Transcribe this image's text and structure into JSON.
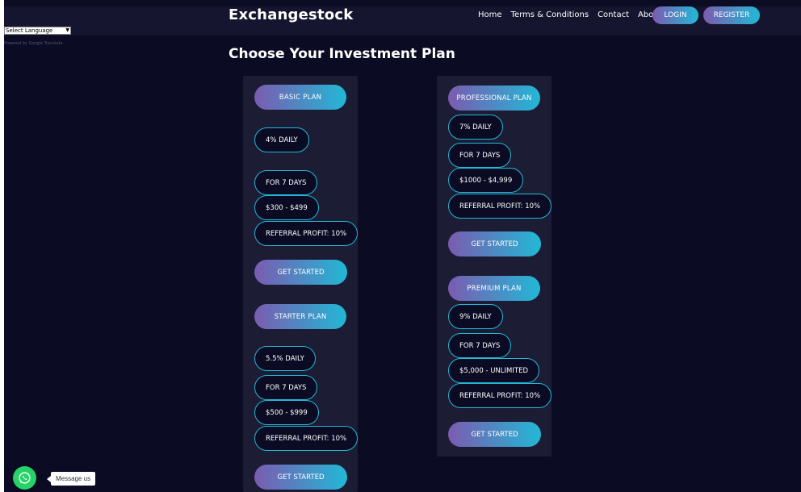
{
  "header": {
    "brand": "Exchangestock",
    "nav": [
      "Home",
      "Terms & Conditions",
      "Contact",
      "About"
    ],
    "login_label": "LOGIN",
    "register_label": "REGISTER"
  },
  "translate": {
    "select_label": "Select Language",
    "powered_by": "Powered by Google Translate"
  },
  "main": {
    "title": "Choose Your Investment Plan"
  },
  "plans": {
    "basic": {
      "name": "BASIC PLAN",
      "rate": "4% DAILY",
      "duration": "FOR 7 DAYS",
      "range": "$300 - $499",
      "referral": "REFERRAL PROFIT: 10%",
      "cta": "GET STARTED"
    },
    "starter": {
      "name": "STARTER PLAN",
      "rate": "5.5% DAILY",
      "duration": "FOR 7 DAYS",
      "range": "$500 - $999",
      "referral": "REFERRAL PROFIT: 10%",
      "cta": "GET STARTED"
    },
    "professional": {
      "name": "PROFESSIONAL PLAN",
      "rate": "7% DAILY",
      "duration": "FOR 7 DAYS",
      "range": "$1000 - $4,999",
      "referral": "REFERRAL PROFIT: 10%",
      "cta": "GET STARTED"
    },
    "premium": {
      "name": "PREMIUM PLAN",
      "rate": "9% DAILY",
      "duration": "FOR 7 DAYS",
      "range": "$5,000 - UNLIMITED",
      "referral": "REFERRAL PROFIT: 10%",
      "cta": "GET STARTED"
    }
  },
  "chat": {
    "label": "Message us",
    "icon": "whatsapp-icon"
  },
  "colors": {
    "background": "#0b0b24",
    "card": "#1c1c35",
    "accent_start": "#7b5bb0",
    "accent_end": "#22b8d6",
    "whatsapp": "#25d366"
  }
}
